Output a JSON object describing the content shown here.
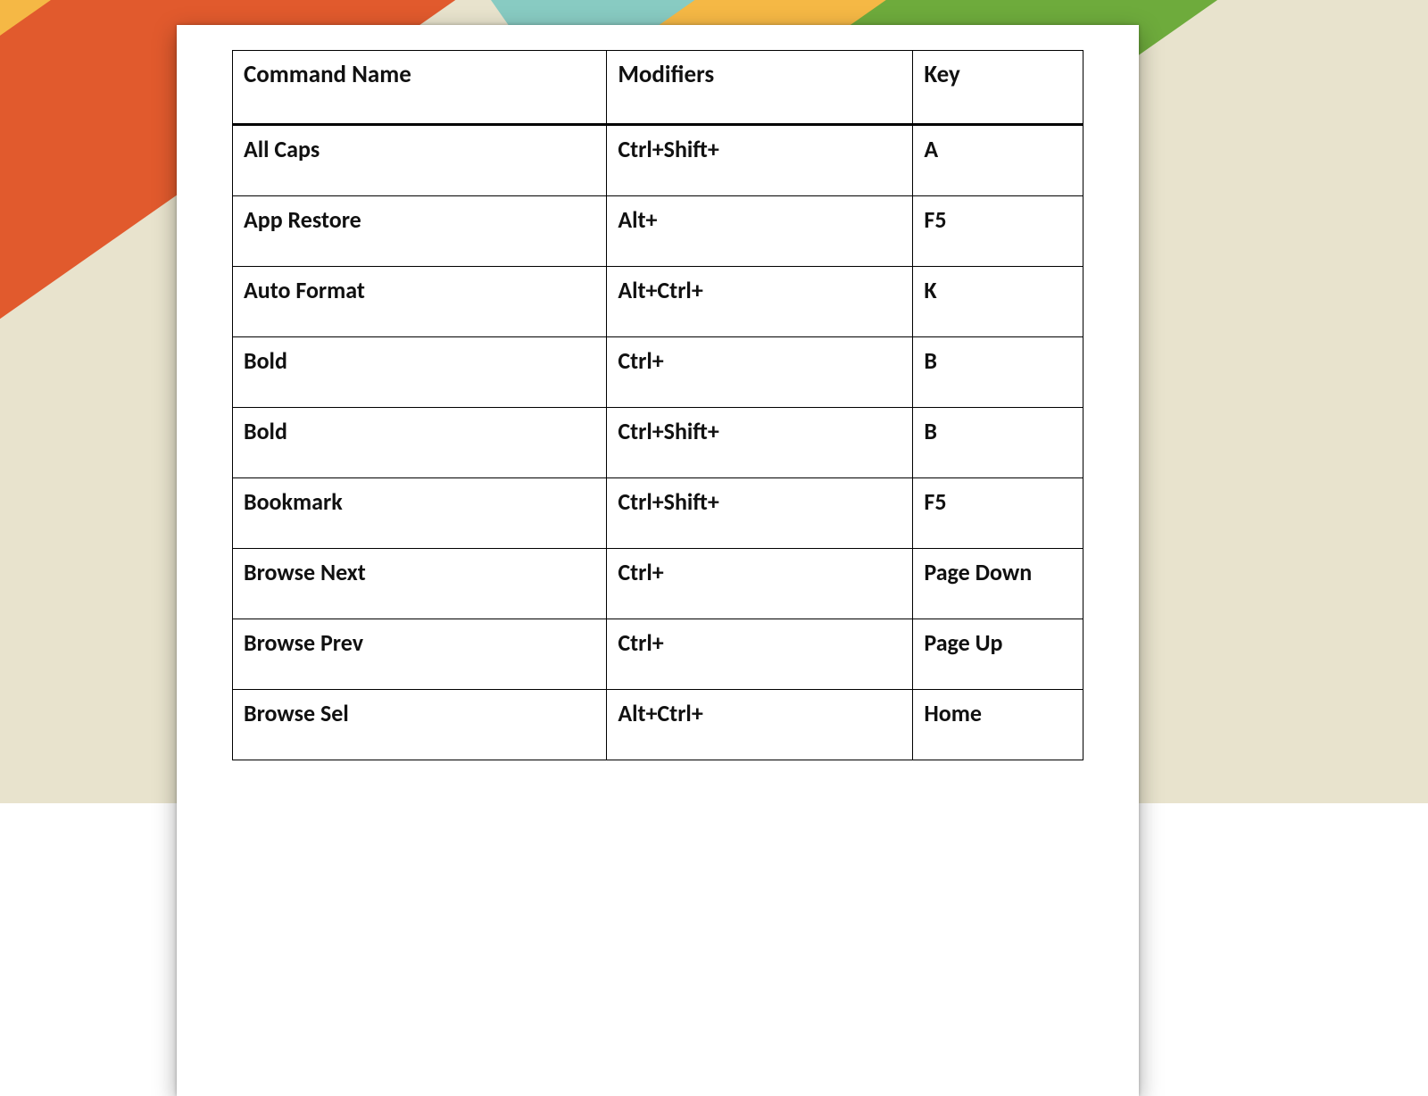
{
  "table": {
    "headers": {
      "command": "Command Name",
      "modifiers": "Modifiers",
      "key": "Key"
    },
    "rows": [
      {
        "command": "All Caps",
        "modifiers": "Ctrl+Shift+",
        "key": "A"
      },
      {
        "command": "App Restore",
        "modifiers": "Alt+",
        "key": "F5"
      },
      {
        "command": "Auto Format",
        "modifiers": "Alt+Ctrl+",
        "key": "K"
      },
      {
        "command": "Bold",
        "modifiers": "Ctrl+",
        "key": "B"
      },
      {
        "command": "Bold",
        "modifiers": "Ctrl+Shift+",
        "key": "B"
      },
      {
        "command": "Bookmark",
        "modifiers": "Ctrl+Shift+",
        "key": "F5"
      },
      {
        "command": "Browse Next",
        "modifiers": "Ctrl+",
        "key": "Page Down"
      },
      {
        "command": "Browse Prev",
        "modifiers": "Ctrl+",
        "key": "Page Up"
      },
      {
        "command": "Browse Sel",
        "modifiers": "Alt+Ctrl+",
        "key": "Home"
      }
    ]
  }
}
